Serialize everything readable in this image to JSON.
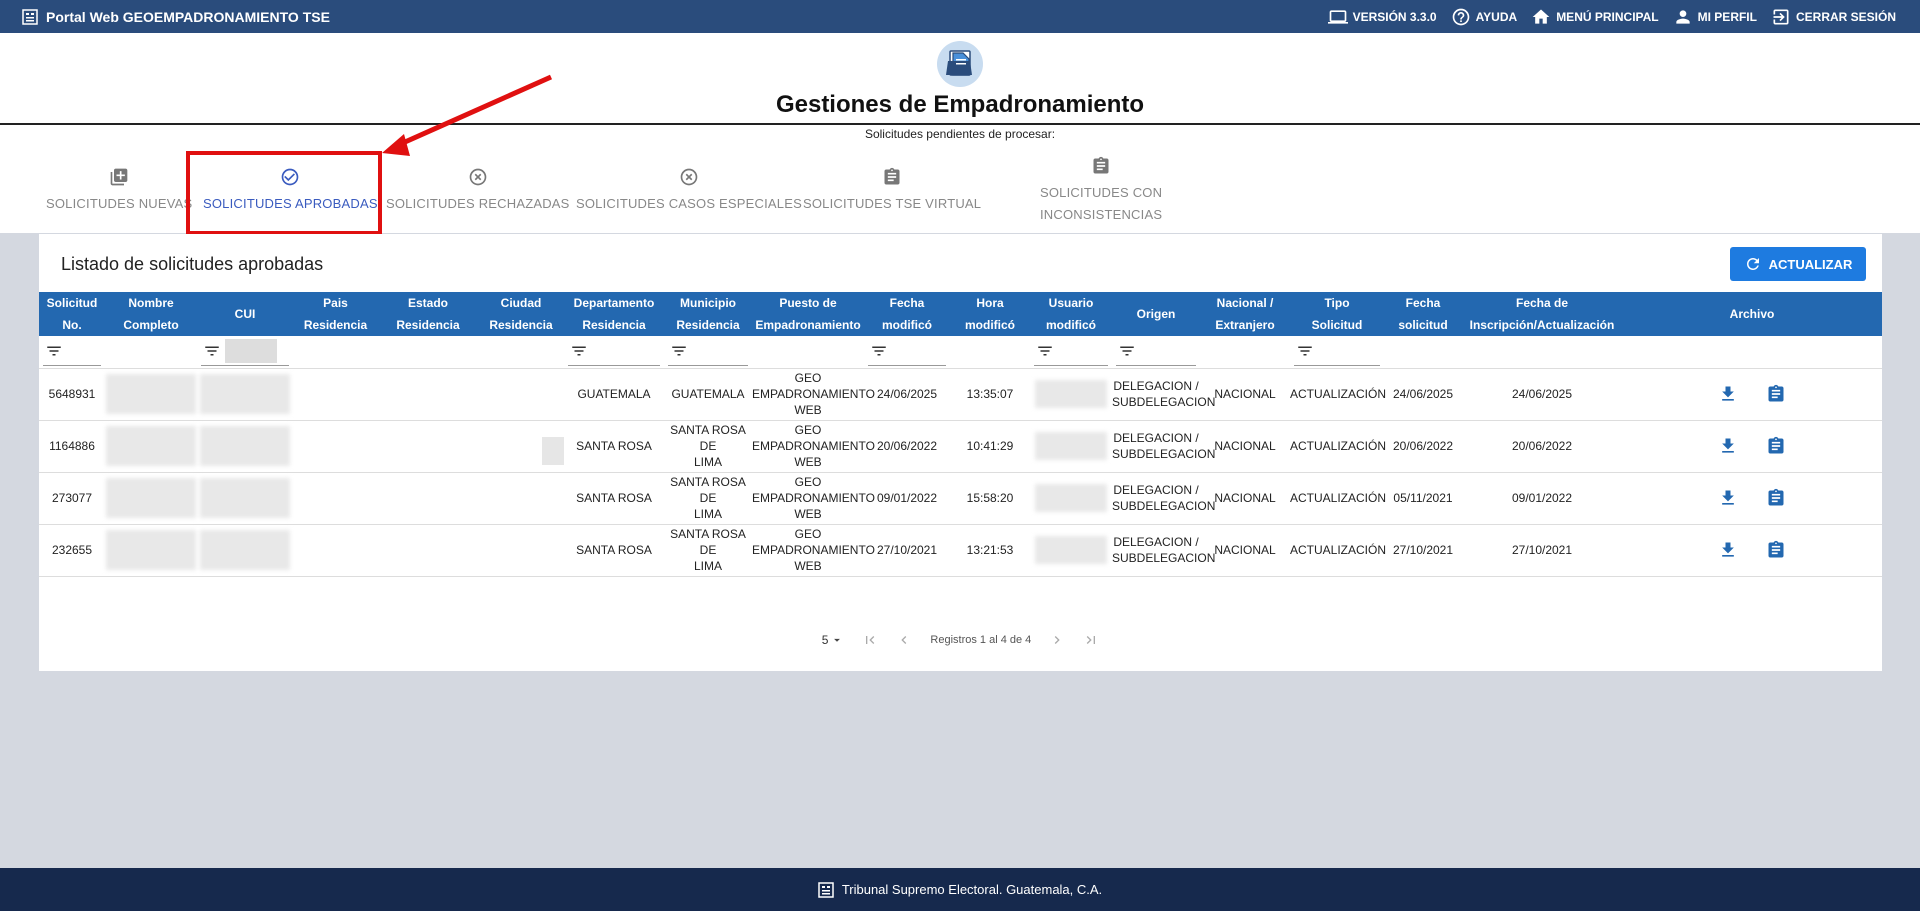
{
  "topbar": {
    "app_title": "Portal Web GEOEMPADRONAMIENTO TSE",
    "version": "VERSIÓN 3.3.0",
    "help": "AYUDA",
    "main_menu": "MENÚ PRINCIPAL",
    "profile": "MI PERFIL",
    "logout": "CERRAR SESIÓN"
  },
  "header": {
    "title": "Gestiones de Empadronamiento",
    "subtitle": "Solicitudes pendientes de procesar:"
  },
  "tabs": [
    {
      "label": "SOLICITUDES NUEVAS",
      "icon": "library-add-icon",
      "active": false
    },
    {
      "label": "SOLICITUDES APROBADAS",
      "icon": "check-circle-icon",
      "active": true
    },
    {
      "label": "SOLICITUDES RECHAZADAS",
      "icon": "cancel-circle-icon",
      "active": false
    },
    {
      "label": "SOLICITUDES CASOS ESPECIALES",
      "icon": "cancel-circle-icon",
      "active": false
    },
    {
      "label": "SOLICITUDES TSE VIRTUAL",
      "icon": "clipboard-icon",
      "active": false
    },
    {
      "label_line1": "SOLICITUDES CON",
      "label_line2": "INCONSISTENCIAS",
      "icon": "clipboard-icon",
      "active": false
    }
  ],
  "card": {
    "title": "Listado de solicitudes aprobadas",
    "refresh_label": "ACTUALIZAR"
  },
  "table": {
    "columns": [
      {
        "l1": "Solicitud",
        "l2": "No."
      },
      {
        "l1": "Nombre",
        "l2": "Completo"
      },
      {
        "l1": "CUI",
        "l2": ""
      },
      {
        "l1": "Pais",
        "l2": "Residencia"
      },
      {
        "l1": "Estado",
        "l2": "Residencia"
      },
      {
        "l1": "Ciudad",
        "l2": "Residencia"
      },
      {
        "l1": "Departamento",
        "l2": "Residencia"
      },
      {
        "l1": "Municipio",
        "l2": "Residencia"
      },
      {
        "l1": "Puesto de",
        "l2": "Empadronamiento"
      },
      {
        "l1": "Fecha",
        "l2": "modificó"
      },
      {
        "l1": "Hora",
        "l2": "modificó"
      },
      {
        "l1": "Usuario",
        "l2": "modificó"
      },
      {
        "l1": "Origen",
        "l2": ""
      },
      {
        "l1": "Nacional /",
        "l2": "Extranjero"
      },
      {
        "l1": "Tipo",
        "l2": "Solicitud"
      },
      {
        "l1": "Fecha",
        "l2": "solicitud"
      },
      {
        "l1": "Fecha de",
        "l2": "Inscripción/Actualización"
      },
      {
        "l1": "Archivo",
        "l2": ""
      }
    ],
    "rows": [
      {
        "solicitud": "5648931",
        "departamento": "GUATEMALA",
        "municipio": "GUATEMALA",
        "puesto": [
          "GEO",
          "EMPADRONAMIENTO",
          "WEB"
        ],
        "fecha_mod": "24/06/2025",
        "hora_mod": "13:35:07",
        "origen": [
          "DELEGACION /",
          "SUBDELEGACION"
        ],
        "nacional": "NACIONAL",
        "tipo": "ACTUALIZACIÓN",
        "fecha_sol": "24/06/2025",
        "fecha_insc": "24/06/2025"
      },
      {
        "solicitud": "1164886",
        "departamento": "SANTA ROSA",
        "municipio": [
          "SANTA ROSA DE",
          "LIMA"
        ],
        "puesto": [
          "GEO",
          "EMPADRONAMIENTO",
          "WEB"
        ],
        "fecha_mod": "20/06/2022",
        "hora_mod": "10:41:29",
        "origen": [
          "DELEGACION /",
          "SUBDELEGACION"
        ],
        "nacional": "NACIONAL",
        "tipo": "ACTUALIZACIÓN",
        "fecha_sol": "20/06/2022",
        "fecha_insc": "20/06/2022"
      },
      {
        "solicitud": "273077",
        "departamento": "SANTA ROSA",
        "municipio": [
          "SANTA ROSA DE",
          "LIMA"
        ],
        "puesto": [
          "GEO",
          "EMPADRONAMIENTO",
          "WEB"
        ],
        "fecha_mod": "09/01/2022",
        "hora_mod": "15:58:20",
        "origen": [
          "DELEGACION /",
          "SUBDELEGACION"
        ],
        "nacional": "NACIONAL",
        "tipo": "ACTUALIZACIÓN",
        "fecha_sol": "05/11/2021",
        "fecha_insc": "09/01/2022"
      },
      {
        "solicitud": "232655",
        "departamento": "SANTA ROSA",
        "municipio": [
          "SANTA ROSA DE",
          "LIMA"
        ],
        "puesto": [
          "GEO",
          "EMPADRONAMIENTO",
          "WEB"
        ],
        "fecha_mod": "27/10/2021",
        "hora_mod": "13:21:53",
        "origen": [
          "DELEGACION /",
          "SUBDELEGACION"
        ],
        "nacional": "NACIONAL",
        "tipo": "ACTUALIZACIÓN",
        "fecha_sol": "27/10/2021",
        "fecha_insc": "27/10/2021"
      }
    ]
  },
  "paginator": {
    "page_size": "5",
    "range_label": "Registros 1 al 4 de 4"
  },
  "footer": {
    "text": "Tribunal Supremo Electoral. Guatemala, C.A."
  },
  "colors": {
    "topbar": "#2a4c7c",
    "table_header": "#2368b0",
    "accent": "#1e7be0",
    "active_tab": "#3a5bbf",
    "highlight": "#e01010",
    "footer": "#16294d"
  }
}
